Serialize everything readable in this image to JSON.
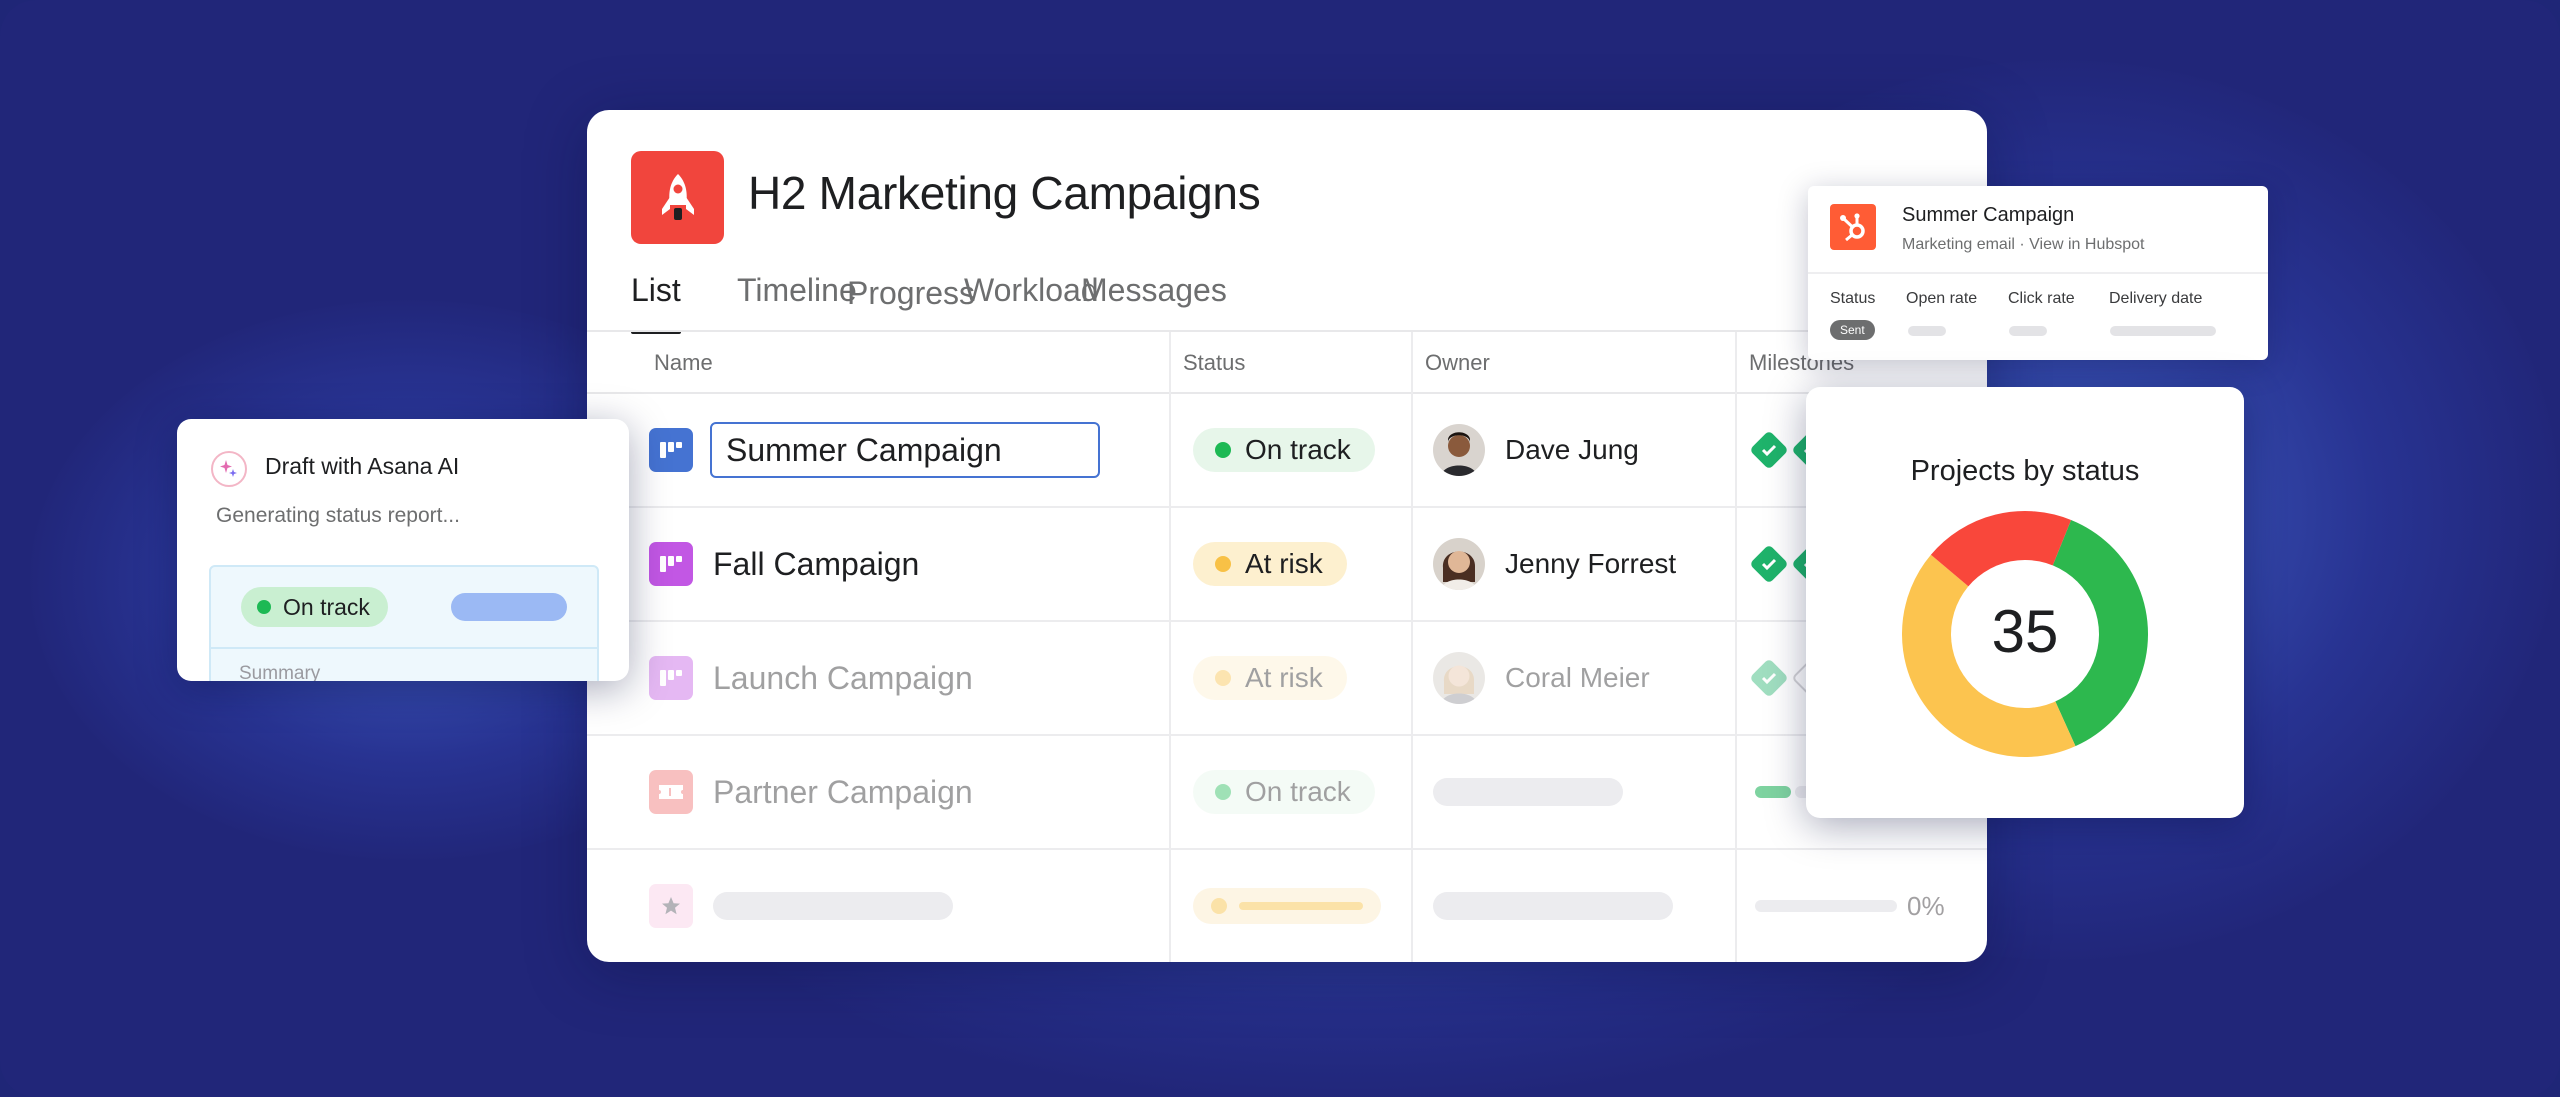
{
  "project": {
    "title": "H2 Marketing Campaigns",
    "icon": "rocket-icon",
    "icon_color": "#f1453d"
  },
  "tabs": [
    {
      "label": "List",
      "active": true
    },
    {
      "label": "Timeline",
      "active": false
    },
    {
      "label": "Progress",
      "active": false
    },
    {
      "label": "Workload",
      "active": false
    },
    {
      "label": "Messages",
      "active": false
    }
  ],
  "columns": {
    "name": "Name",
    "status": "Status",
    "owner": "Owner",
    "milestones": "Milestones"
  },
  "rows": [
    {
      "name": "Summer Campaign",
      "status": "On track",
      "owner": "Dave Jung",
      "editing": true,
      "icon_color": "#4573d2"
    },
    {
      "name": "Fall Campaign",
      "status": "At risk",
      "owner": "Jenny Forrest",
      "icon_color": "#c257e4"
    },
    {
      "name": "Launch Campaign",
      "status": "At risk",
      "owner": "Coral Meier",
      "icon_color": "#c257e4"
    },
    {
      "name": "Partner Campaign",
      "status": "On track",
      "owner": "",
      "icon_color": "#f06a6a"
    },
    {
      "name": "",
      "status": "",
      "owner": "",
      "milestone_progress": "0%",
      "icon_color": "#f9d4ea"
    }
  ],
  "ai_draft": {
    "title": "Draft with Asana AI",
    "subtitle": "Generating status report...",
    "status": "On track",
    "summary_label": "Summary"
  },
  "hubspot": {
    "title": "Summer Campaign",
    "subtitle": "Marketing email · View in Hubspot",
    "columns": [
      "Status",
      "Open rate",
      "Click rate",
      "Delivery date"
    ],
    "status_badge": "Sent",
    "accent": "#ff5c35"
  },
  "chart_data": {
    "type": "pie",
    "title": "Projects by status",
    "center_label": "35",
    "series": [
      {
        "value": 13,
        "color": "#2db84e"
      },
      {
        "value": 15,
        "color": "#fcc44f"
      },
      {
        "value": 7,
        "color": "#f9473b"
      }
    ]
  }
}
